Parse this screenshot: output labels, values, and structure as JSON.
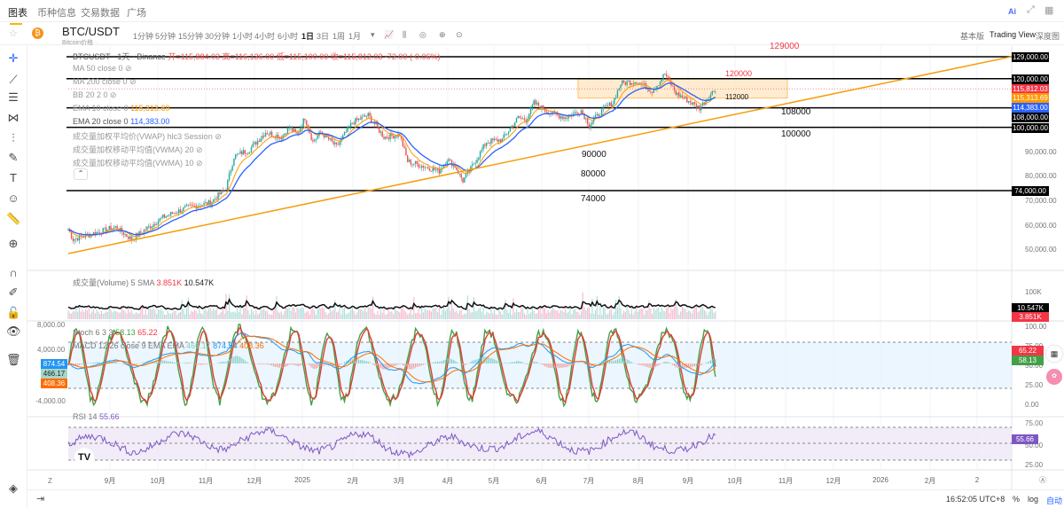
{
  "nav": {
    "tabs": [
      "图表",
      "币种信息",
      "交易数据",
      "广场"
    ],
    "right_icons": [
      "ai-icon",
      "expand-icon",
      "layout-icon"
    ],
    "ai_label": "Ai"
  },
  "header": {
    "symbol": "BTC/USDT",
    "subtitle": "Bitcoin价格 ·",
    "timeframes": [
      "1分钟",
      "5分钟",
      "15分钟",
      "30分钟",
      "1小时",
      "4小时",
      "6小时",
      "1日",
      "3日",
      "1周",
      "1月"
    ],
    "active_timeframe": "1日",
    "modes": [
      "基本版",
      "Trading View",
      "深度图"
    ]
  },
  "legend": {
    "title": "BTCUSDT · 1天 · Binance",
    "ohlc": "开=115,884.03 高=116,136.00 低=115,100.00 收=115,812.03 -72.00 (-0.06%)",
    "indicators": [
      {
        "label": "MA 50 close 0",
        "value": ""
      },
      {
        "label": "MA 200 close 0",
        "value": ""
      },
      {
        "label": "BB 20 2 0",
        "value": ""
      },
      {
        "label": "EMA 10 close 0",
        "value": "115,313.69"
      },
      {
        "label": "EMA 20 close 0",
        "value": "114,383.00"
      },
      {
        "label": "成交量加权平均价(VWAP) hlc3 Session",
        "value": ""
      },
      {
        "label": "成交量加权移动平均值(VWMA) 20",
        "value": ""
      },
      {
        "label": "成交量加权移动平均值(VWMA) 10",
        "value": ""
      }
    ]
  },
  "annotations": {
    "l129": "129000",
    "l120": "120000",
    "l112": "112000",
    "l108": "108000",
    "l100": "100000",
    "l90": "90000",
    "l80": "80000",
    "l74": "74000"
  },
  "price_axis": {
    "ticks": [
      "90,000.00",
      "80,000.00",
      "70,000.00",
      "60,000.00",
      "50,000.00"
    ],
    "tags": [
      {
        "v": "129,000.00",
        "c": "#000000"
      },
      {
        "v": "120,000.00",
        "c": "#000000"
      },
      {
        "v": "115,812.03",
        "c": "#f23645"
      },
      {
        "v": "115,313.69",
        "c": "#ff9800"
      },
      {
        "v": "114,383.00",
        "c": "#2962ff"
      },
      {
        "v": "108,000.00",
        "c": "#000000"
      },
      {
        "v": "100,000.00",
        "c": "#000000"
      },
      {
        "v": "74,000.00",
        "c": "#000000"
      }
    ]
  },
  "volume": {
    "label": "成交量(Volume) 5 SMA",
    "v1": "3.851K",
    "v2": "10.547K",
    "axis": "100K"
  },
  "stoch": {
    "label": "Stoch 6 3 3",
    "k": "58.13",
    "d": "65.22",
    "axis": [
      "100.00",
      "75.00",
      "50.00",
      "25.00",
      "0.00"
    ]
  },
  "macd": {
    "label": "MACD 12 26 close 9 EMA EMA",
    "hist": "466.17",
    "macd": "874.54",
    "signal": "408.36",
    "axis": [
      "8,000.00",
      "4,000.00",
      "-4,000.00"
    ]
  },
  "rsi": {
    "label": "RSI 14",
    "value": "55.66",
    "axis": [
      "75.00",
      "50.00",
      "25.00"
    ]
  },
  "time_axis": [
    "9月",
    "10月",
    "11月",
    "12月",
    "2025",
    "2月",
    "3月",
    "4月",
    "5月",
    "6月",
    "7月",
    "8月",
    "9月",
    "10月",
    "11月",
    "12月",
    "2026",
    "2月",
    "2"
  ],
  "bottom": {
    "time": "16:52:05 UTC+8",
    "pct": "%",
    "log": "log",
    "auto": "自动",
    "tz": "Z"
  },
  "colors": {
    "up": "#26a69a",
    "down": "#ef5350",
    "accent": "#f0b90b",
    "ema10": "#ff9800",
    "ema20": "#2962ff",
    "trend": "#f59e0b"
  },
  "chart_data": {
    "type": "candlestick",
    "price_path_days_since_2024_08_03": [
      [
        0,
        58000
      ],
      [
        3,
        54000
      ],
      [
        30,
        59000
      ],
      [
        40,
        54000
      ],
      [
        60,
        63000
      ],
      [
        75,
        67000
      ],
      [
        90,
        69000
      ],
      [
        100,
        75000
      ],
      [
        105,
        88000
      ],
      [
        115,
        91000
      ],
      [
        125,
        98000
      ],
      [
        135,
        96000
      ],
      [
        140,
        100000
      ],
      [
        145,
        97000
      ],
      [
        150,
        104000
      ],
      [
        155,
        94000
      ],
      [
        160,
        98000
      ],
      [
        170,
        92000
      ],
      [
        180,
        102000
      ],
      [
        190,
        105000
      ],
      [
        200,
        96000
      ],
      [
        210,
        97000
      ],
      [
        215,
        86000
      ],
      [
        225,
        84000
      ],
      [
        235,
        82000
      ],
      [
        240,
        87000
      ],
      [
        245,
        84000
      ],
      [
        250,
        78000
      ],
      [
        255,
        83000
      ],
      [
        265,
        94000
      ],
      [
        275,
        95000
      ],
      [
        285,
        104000
      ],
      [
        290,
        103000
      ],
      [
        295,
        110000
      ],
      [
        305,
        106000
      ],
      [
        315,
        104000
      ],
      [
        325,
        107000
      ],
      [
        330,
        101000
      ],
      [
        340,
        108000
      ],
      [
        345,
        110000
      ],
      [
        350,
        118000
      ],
      [
        360,
        119000
      ],
      [
        370,
        115000
      ],
      [
        375,
        119000
      ],
      [
        378,
        122000
      ],
      [
        385,
        114000
      ],
      [
        395,
        110000
      ],
      [
        400,
        108000
      ],
      [
        405,
        112000
      ],
      [
        410,
        115812
      ]
    ],
    "levels": [
      129000,
      120000,
      108000,
      100000,
      74000
    ],
    "range_box": [
      112000,
      120000
    ]
  }
}
